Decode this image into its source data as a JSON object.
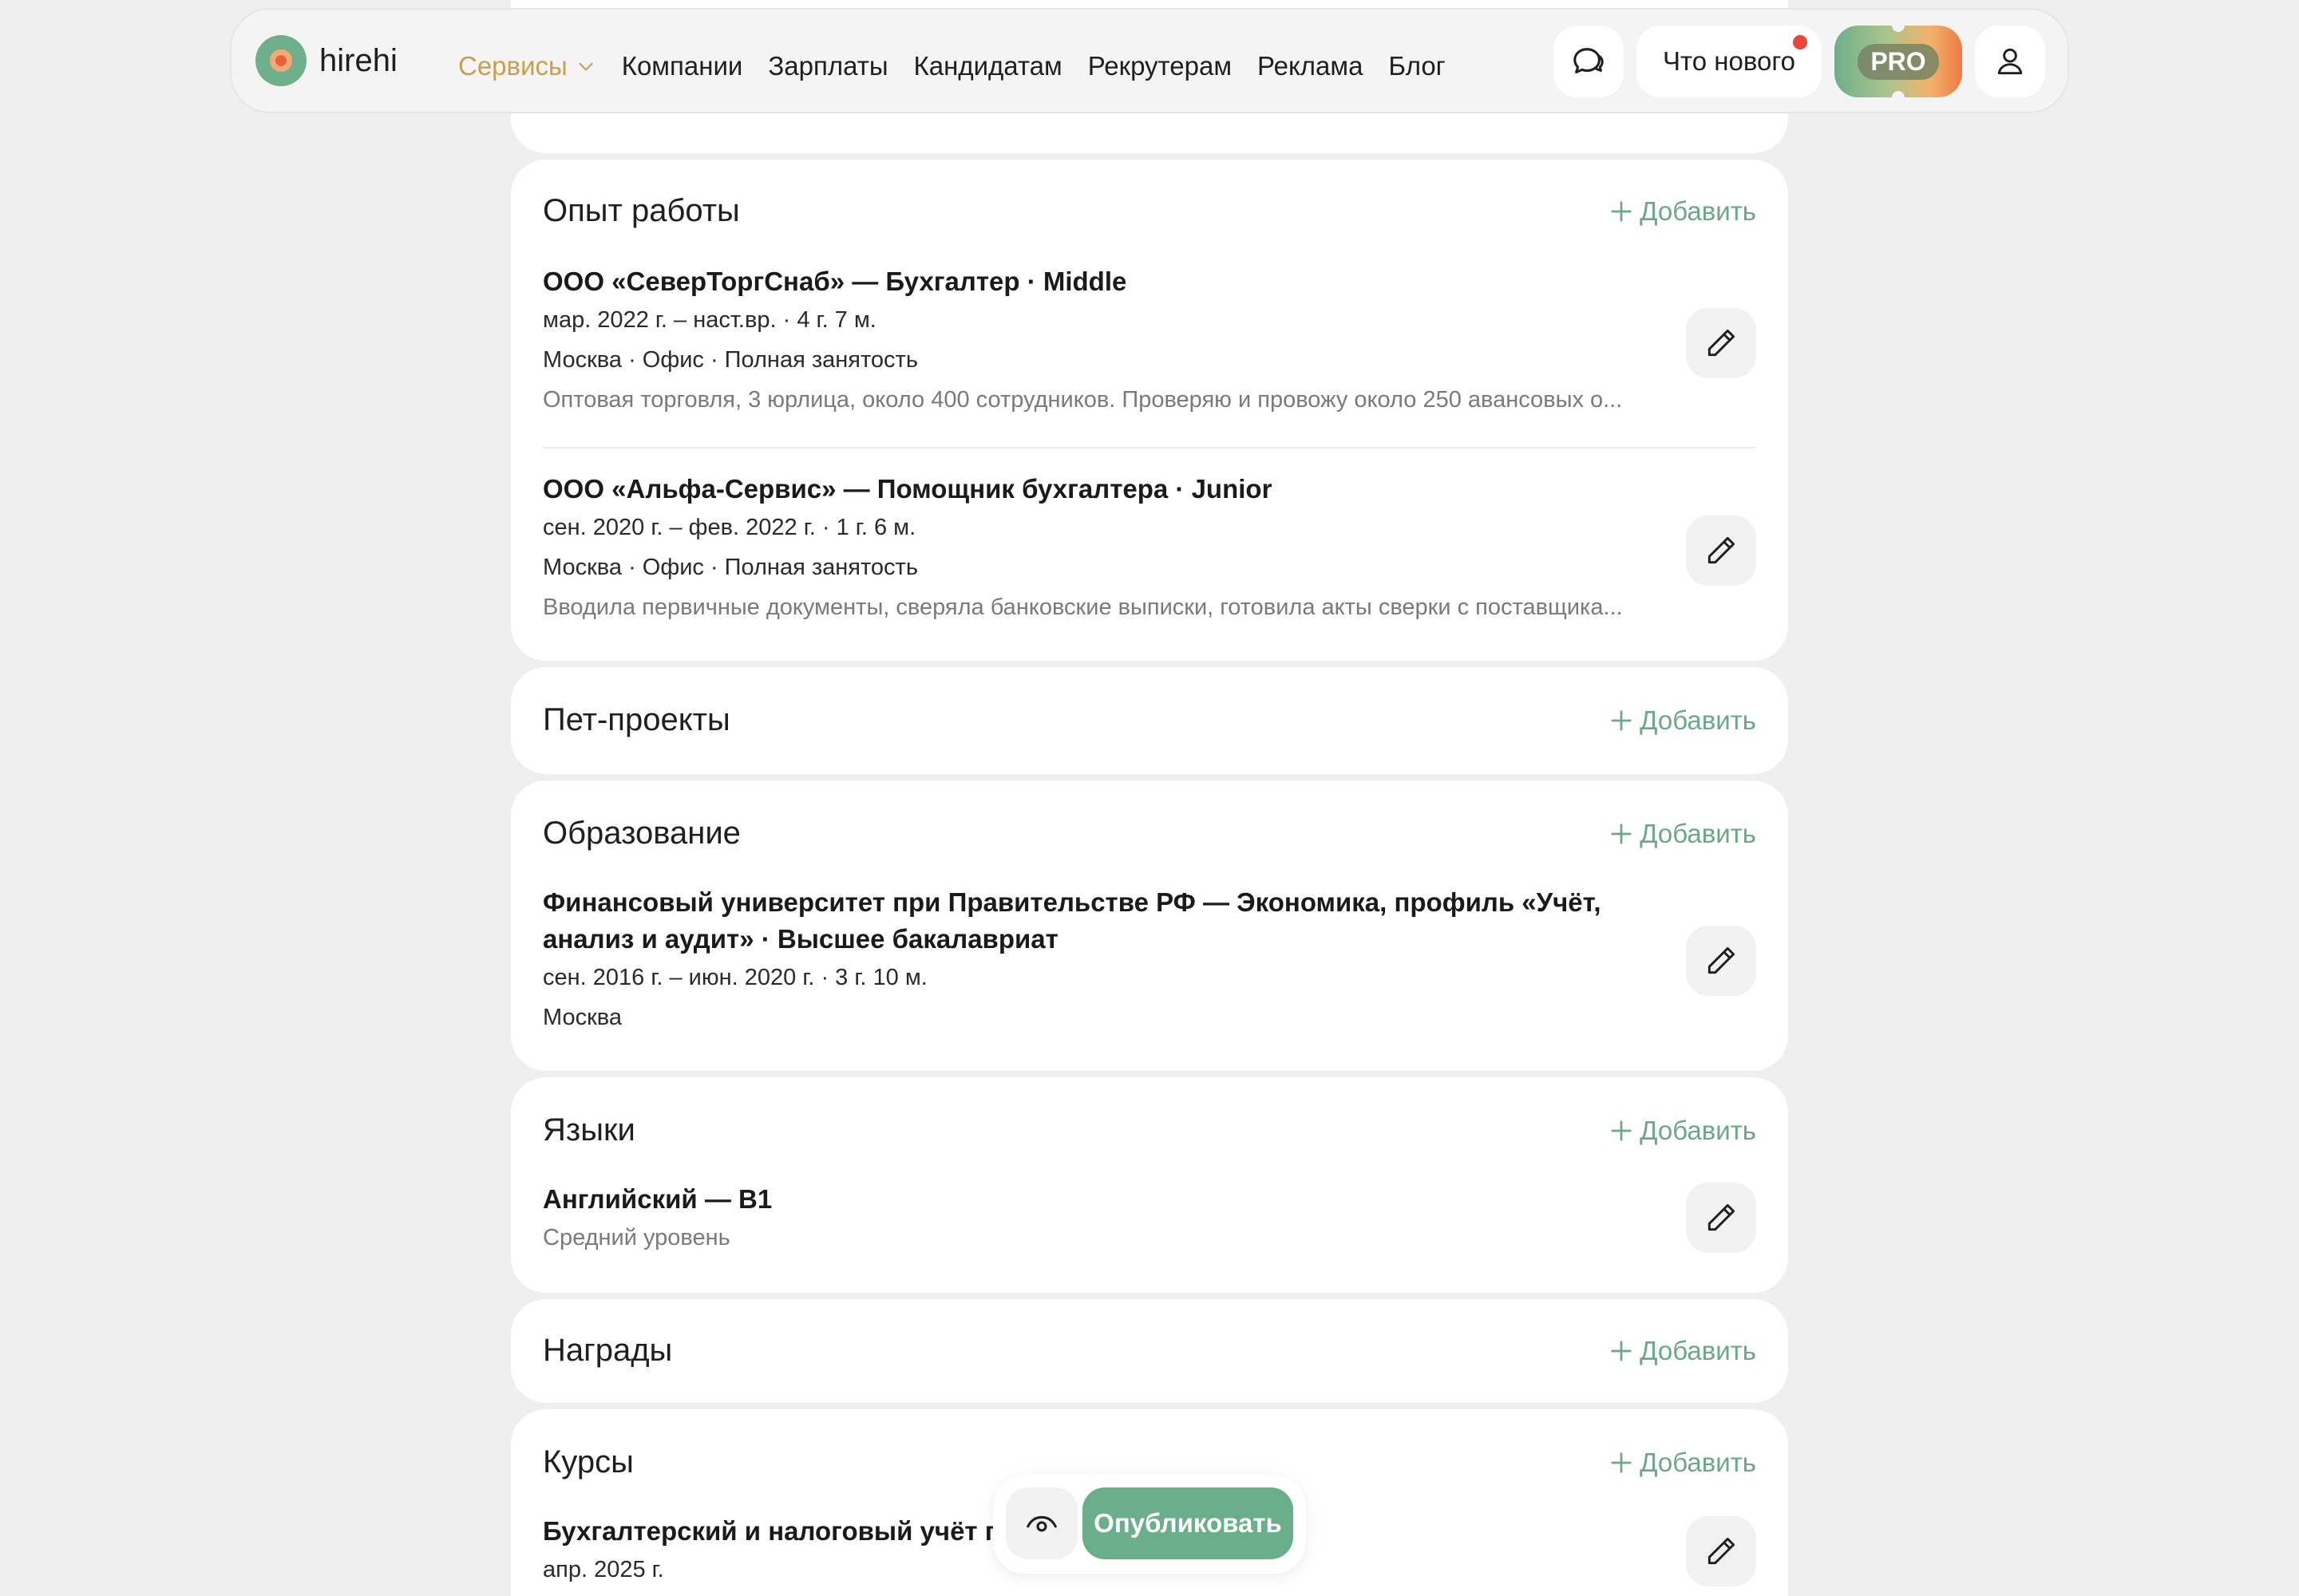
{
  "header": {
    "logo_text": "hirehi",
    "nav": [
      "Сервисы",
      "Компании",
      "Зарплаты",
      "Кандидатам",
      "Рекрутерам",
      "Реклама",
      "Блог"
    ],
    "news_label": "Что нового",
    "pro_label": "PRO"
  },
  "add_label": "Добавить",
  "sections": {
    "experience": {
      "title": "Опыт работы",
      "entries": [
        {
          "title": "ООО «СеверТоргСнаб» — Бухгалтер · Middle",
          "period": "мар. 2022 г. – наст.вр. · 4 г. 7 м.",
          "location": "Москва · Офис · Полная занятость",
          "description": "Оптовая торговля, 3 юрлица, около 400 сотрудников. Проверяю и провожу около 250 авансовых о..."
        },
        {
          "title": "ООО «Альфа-Сервис» — Помощник бухгалтера · Junior",
          "period": "сен. 2020 г. – фев. 2022 г. · 1 г. 6 м.",
          "location": "Москва · Офис · Полная занятость",
          "description": "Вводила первичные документы, сверяла банковские выписки, готовила акты сверки с поставщика..."
        }
      ]
    },
    "pet_projects": {
      "title": "Пет-проекты"
    },
    "education": {
      "title": "Образование",
      "entry": {
        "title": "Финансовый университет при Правительстве РФ — Экономика, профиль «Учёт, анализ и аудит» · Высшее бакалавриат",
        "period": "сен. 2016 г. – июн. 2020 г. · 3 г. 10 м.",
        "location": "Москва"
      }
    },
    "languages": {
      "title": "Языки",
      "entry": {
        "title": "Английский — B1",
        "level": "Средний уровень"
      }
    },
    "awards": {
      "title": "Награды"
    },
    "courses": {
      "title": "Курсы",
      "entry": {
        "title": "Бухгалтерский и налоговый учёт по Ф",
        "period": "апр. 2025 г."
      }
    }
  },
  "float_bar": {
    "publish_label": "Опубликовать"
  },
  "colors": {
    "accent_green": "#6aae8a",
    "nav_active": "#c9a04d",
    "background": "#efefef",
    "notification_dot": "#e8473a"
  }
}
